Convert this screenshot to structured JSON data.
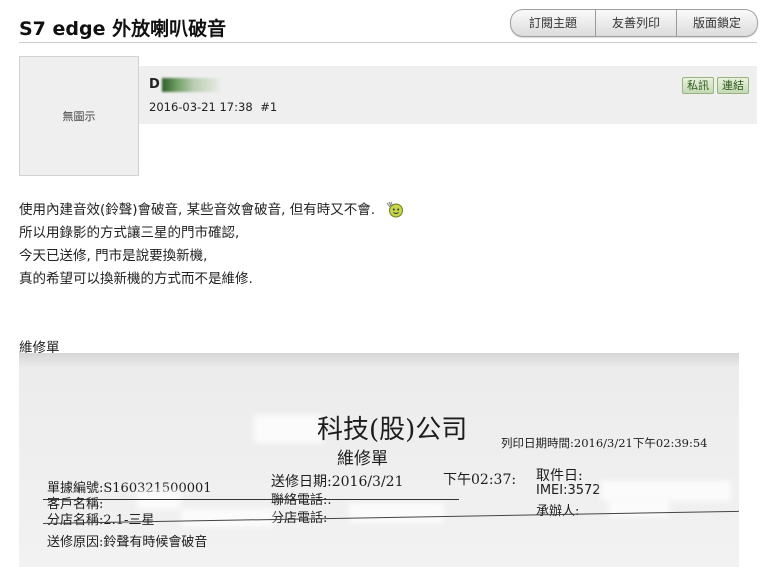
{
  "thread": {
    "title": "S7 edge 外放喇叭破音",
    "buttons": {
      "subscribe": "訂閱主題",
      "print": "友善列印",
      "lock_layout": "版面鎖定"
    }
  },
  "post": {
    "avatar_placeholder": "無圖示",
    "username_initial": "D",
    "datetime": "2016-03-21 17:38",
    "post_number": "#1",
    "actions": {
      "private_message": "私訊",
      "link": "連結"
    },
    "body_lines": [
      "使用內建音效(鈴聲)會破音, 某些音效會破音, 但有時又不會.",
      "所以用錄影的方式讓三星的門市確認,",
      "今天已送修, 門市是說要換新機,",
      "真的希望可以換新機的方式而不是維修."
    ],
    "caption": "維修單"
  },
  "receipt": {
    "company": "科技(股)公司",
    "doc_title": "維修單",
    "print_time": "列印日期時間:2016/3/21下午02:39:54",
    "order_no": "單據編號:S160321500001",
    "customer": "客戶名稱:",
    "branch": "分店名稱:2.1-三星",
    "send_date": "送修日期:2016/3/21",
    "time": "下午02:37:",
    "pickup": "取件日:",
    "phone": "聯絡電話:.",
    "branch_phone": "分店電話:",
    "imei": "IMEI:3572",
    "handler": "承辦人:",
    "reason": "送修原因:鈴聲有時候會破音"
  }
}
